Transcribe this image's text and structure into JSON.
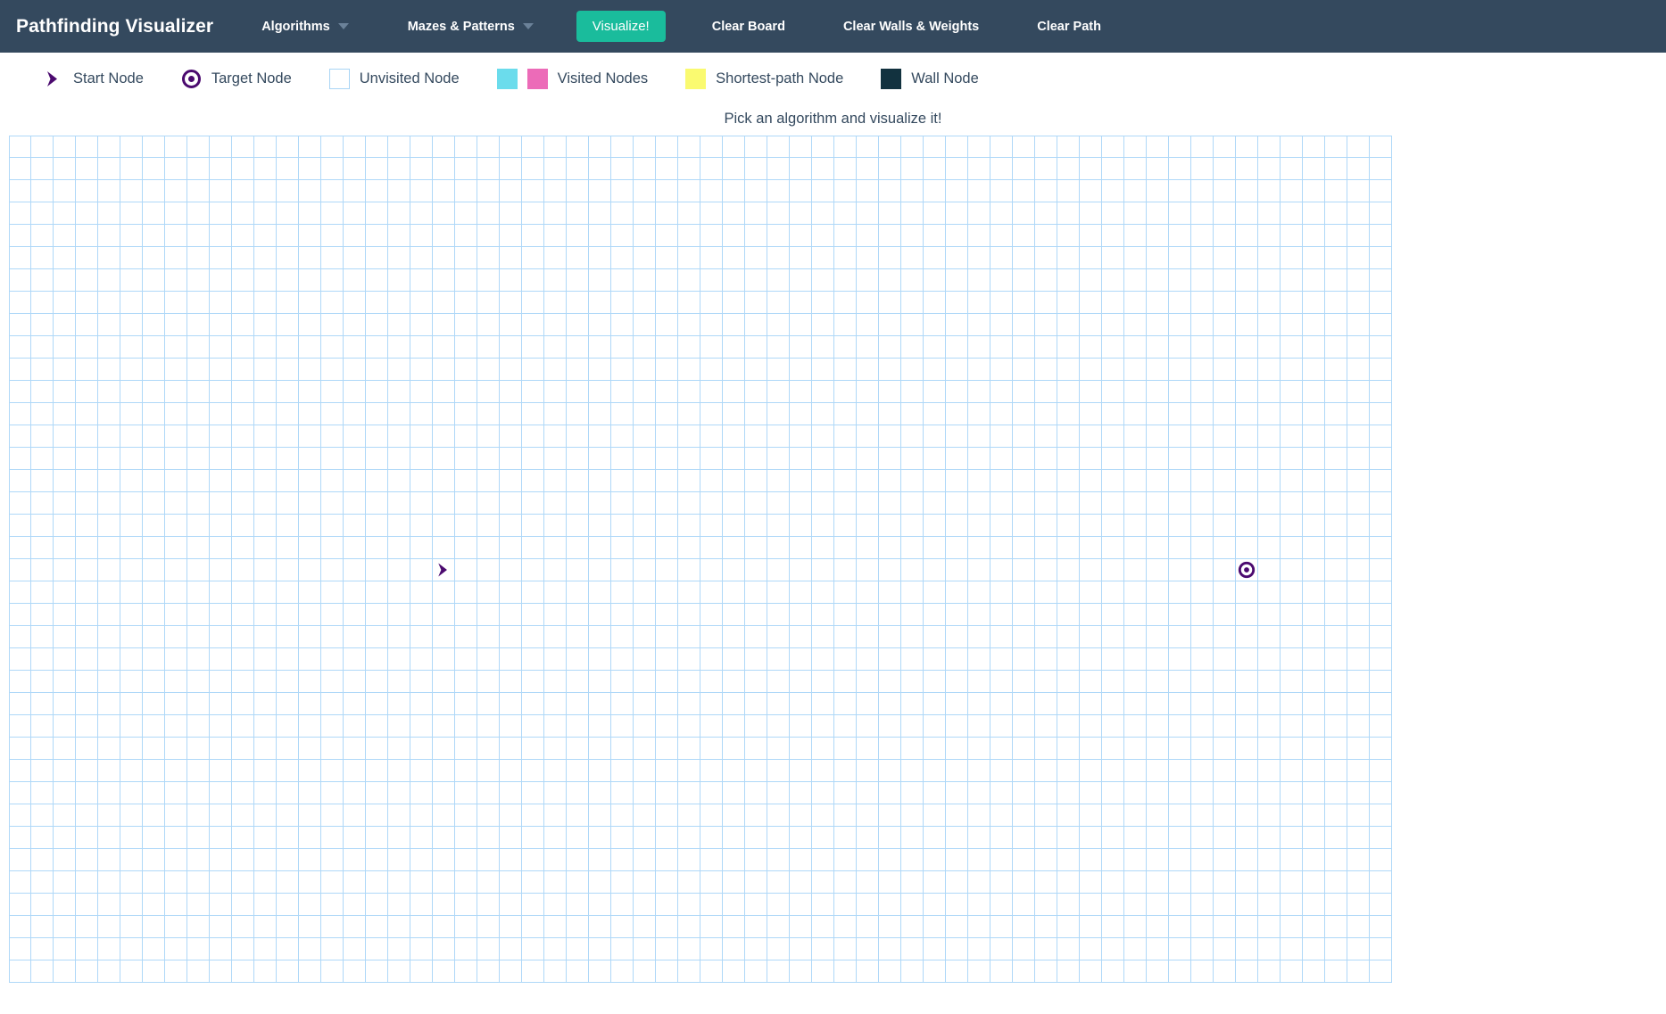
{
  "navbar": {
    "brand": "Pathfinding Visualizer",
    "algorithms_label": "Algorithms",
    "mazes_label": "Mazes & Patterns",
    "visualize_label": "Visualize!",
    "clear_board_label": "Clear Board",
    "clear_walls_label": "Clear Walls & Weights",
    "clear_path_label": "Clear Path",
    "background_color": "#34495e",
    "visualize_color": "#1abc9c",
    "caret_icon": "chevron-down-icon"
  },
  "legend": {
    "items": [
      {
        "label": "Start Node",
        "icon": "chevron-right-arrow-icon",
        "color": "#4b0a6f"
      },
      {
        "label": "Target Node",
        "icon": "bullseye-target-icon",
        "color": "#4b0a6f"
      },
      {
        "label": "Unvisited Node",
        "icon": "empty-square-swatch",
        "color": "#ffffff",
        "border_color": "#a9d5f5"
      },
      {
        "label": "Visited Nodes",
        "icon": "two-color-swatch",
        "color": "#6bdcec",
        "color2": "#ec6bb8"
      },
      {
        "label": "Shortest-path Node",
        "icon": "square-swatch",
        "color": "#fafa70"
      },
      {
        "label": "Wall Node",
        "icon": "square-swatch",
        "color": "#12323f"
      }
    ]
  },
  "status": {
    "text": "Pick an algorithm and visualize it!"
  },
  "grid": {
    "columns": 62,
    "rows": 38,
    "cell_size": 25,
    "border_color": "#afd8f8",
    "start_node": {
      "row": 19,
      "col": 19
    },
    "target_node": {
      "row": 19,
      "col": 55
    },
    "start_icon": "chevron-right-arrow-icon",
    "target_icon": "bullseye-target-icon",
    "node_color": "#4b0a6f"
  }
}
